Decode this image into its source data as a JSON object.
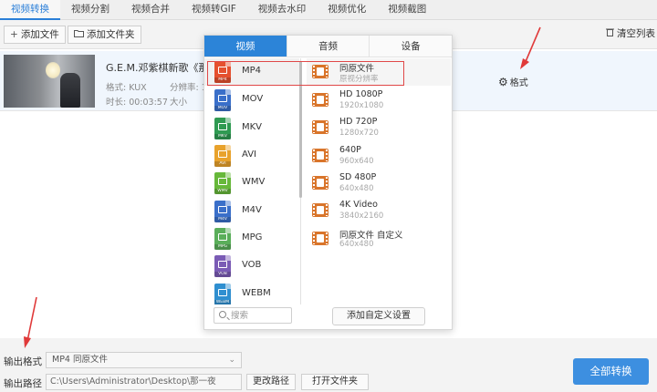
{
  "tabs": [
    "视频转换",
    "视频分割",
    "视频合并",
    "视频转GIF",
    "视频去水印",
    "视频优化",
    "视频截图"
  ],
  "toolbar": {
    "add_file": "添加文件",
    "add_folder": "添加文件夹",
    "clear_list": "清空列表"
  },
  "file": {
    "name": "G.E.M.邓紫棋新歌《那...满",
    "format_label": "格式: KUX",
    "resolution_label": "分辨率: 1",
    "duration_label": "时长: 00:03:57",
    "size_label": "大小",
    "format_button": "格式"
  },
  "popup": {
    "tabs": [
      "视频",
      "音频",
      "设备"
    ],
    "formats": [
      "MP4",
      "MOV",
      "MKV",
      "AVI",
      "WMV",
      "M4V",
      "MPG",
      "VOB",
      "WEBM"
    ],
    "format_colors": [
      "#e5502f",
      "#3a6fc9",
      "#2f9a52",
      "#e8a22c",
      "#67b83a",
      "#3a6fc9",
      "#5aae5a",
      "#7a5bb5",
      "#2f8fd0"
    ],
    "presets": [
      {
        "name": "同原文件",
        "res": "原视分辨率"
      },
      {
        "name": "HD 1080P",
        "res": "1920x1080"
      },
      {
        "name": "HD 720P",
        "res": "1280x720"
      },
      {
        "name": "640P",
        "res": "960x640"
      },
      {
        "name": "SD 480P",
        "res": "640x480"
      },
      {
        "name": "4K Video",
        "res": "3840x2160"
      },
      {
        "name": "同原文件 自定义",
        "res": "640x480"
      }
    ],
    "search_placeholder": "搜索",
    "add_custom": "添加自定义设置"
  },
  "bottom": {
    "output_format_label": "输出格式",
    "output_format_value": "MP4  同原文件",
    "output_path_label": "输出路径",
    "output_path_value": "C:\\Users\\Administrator\\Desktop\\那一夜",
    "change_path": "更改路径",
    "open_folder": "打开文件夹",
    "convert_all": "全部转换"
  },
  "colors": {
    "accent": "#2c84d8",
    "highlight": "#e04848",
    "preset_icon": "#d9752b"
  }
}
